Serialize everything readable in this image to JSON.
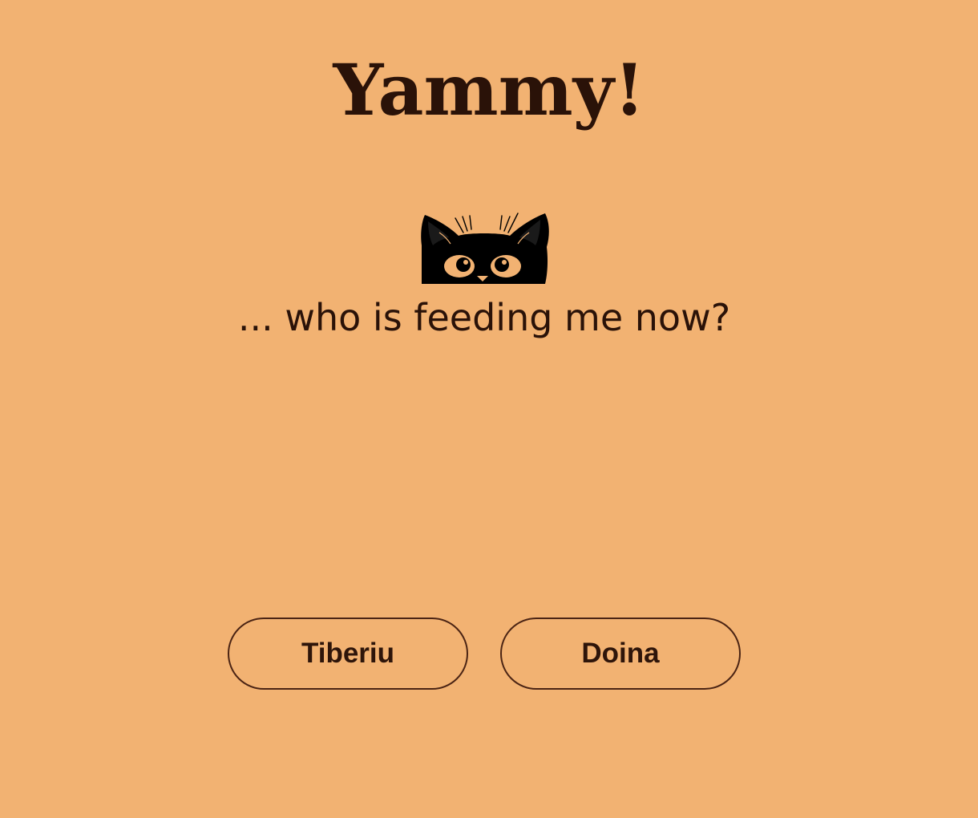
{
  "header": {
    "title": "Yammy!"
  },
  "main": {
    "subtitle": "... who is feeding me now?",
    "illustration_icon": "peeking-cat-icon"
  },
  "choices": [
    {
      "label": "Tiberiu"
    },
    {
      "label": "Doina"
    }
  ],
  "colors": {
    "background": "#f2b272",
    "text": "#2a1208",
    "button_border": "#4b2414"
  }
}
